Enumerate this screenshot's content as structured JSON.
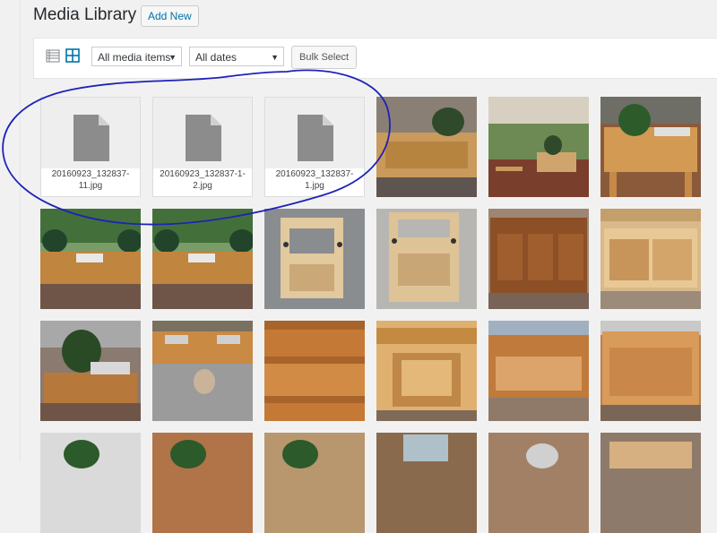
{
  "page": {
    "title": "Media Library",
    "add_new_label": "Add New"
  },
  "toolbar": {
    "list_view_icon": "list-view-icon",
    "grid_view_icon": "grid-view-icon",
    "media_type_filter": "All media items",
    "date_filter": "All dates",
    "bulk_select_label": "Bulk Select"
  },
  "colors": {
    "link_blue": "#0073aa",
    "annotation_blue": "#1e22b8",
    "background": "#f1f1f1"
  },
  "files": [
    {
      "name": "20160923_132837-11.jpg",
      "icon": "document-icon"
    },
    {
      "name": "20160923_132837-1-2.jpg",
      "icon": "document-icon"
    },
    {
      "name": "20160923_132837-1.jpg",
      "icon": "document-icon"
    }
  ]
}
